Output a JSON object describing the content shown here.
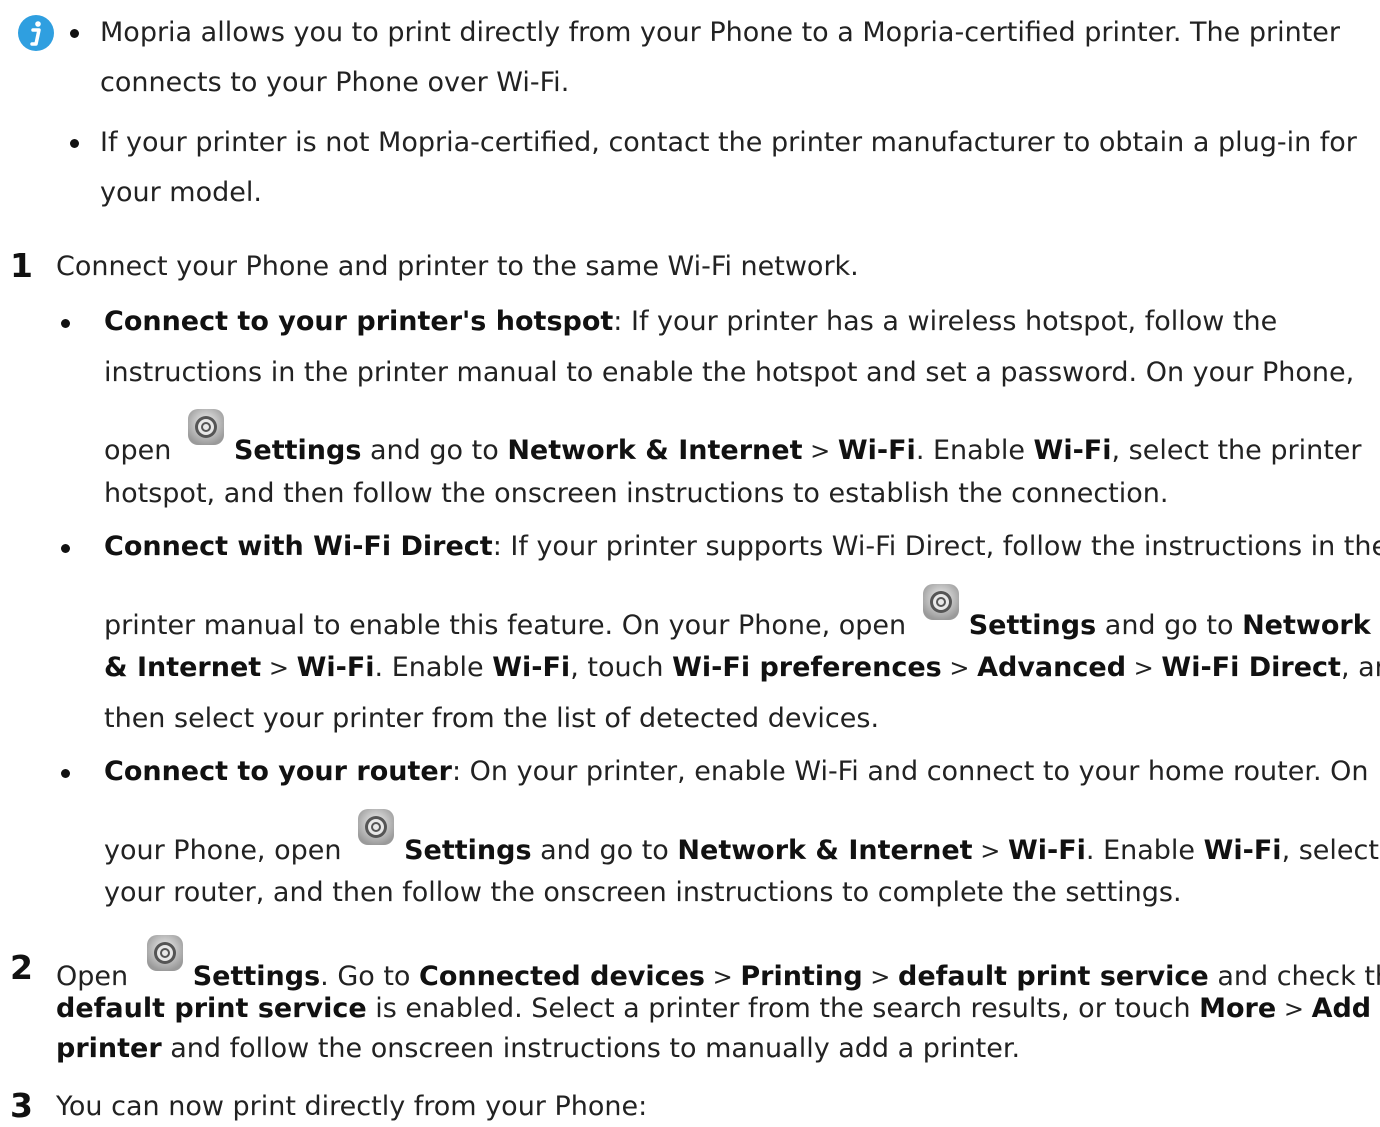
{
  "note": {
    "icon": "info-icon",
    "items": [
      [
        "Mopria allows you to print directly from your Phone to a Mopria-certified printer. The printer",
        "connects to your Phone over Wi-Fi."
      ],
      [
        "If your printer is not Mopria-certified, contact the printer manufacturer to obtain a plug-in for",
        "your model."
      ]
    ]
  },
  "step1": {
    "number": "1",
    "text": "Connect your Phone and printer to the same Wi-Fi network.",
    "b1": {
      "l1_bold": "Connect to your printer's hotspot",
      "l1_rest": ": If your printer has a wireless hotspot, follow the",
      "l2": "instructions in the printer manual to enable the hotspot and set a password. On your Phone,",
      "l3_a": "open ",
      "settings": "Settings",
      "l3_b": " and go to ",
      "network": "Network & Internet",
      "gt": " > ",
      "wifi": "Wi-Fi",
      "l3_c": ". Enable ",
      "wifi2": "Wi-Fi",
      "l3_d": ", select the printer",
      "l4": "hotspot, and then follow the onscreen instructions to establish the connection."
    },
    "b2": {
      "l1_bold": "Connect with Wi-Fi Direct",
      "l1_rest": ": If your printer supports Wi-Fi Direct, follow the instructions in the",
      "l2_a": "printer manual to enable this feature. On your Phone, open ",
      "settings": "Settings",
      "l2_b": " and go to ",
      "network": "Network",
      "l3_a": "& Internet",
      "gt": " > ",
      "wifi": "Wi-Fi",
      "l3_b": ". Enable ",
      "wifi2": "Wi-Fi",
      "l3_c": ", touch ",
      "prefs": "Wi-Fi preferences",
      "advanced": "Advanced",
      "direct": "Wi-Fi Direct",
      "l3_d": ", and",
      "l4": "then select your printer from the list of detected devices."
    },
    "b3": {
      "l1_bold": "Connect to your router",
      "l1_rest": ": On your printer, enable Wi-Fi and connect to your home router. On",
      "l2_a": "your Phone, open ",
      "settings": "Settings",
      "l2_b": " and go to ",
      "network": "Network & Internet",
      "gt": " > ",
      "wifi": "Wi-Fi",
      "l2_c": ". Enable ",
      "wifi2": "Wi-Fi",
      "l2_d": ", select",
      "l3": "your router, and then follow the onscreen instructions to complete the settings."
    }
  },
  "step2": {
    "number": "2",
    "l1_a": "Open ",
    "settings": "Settings",
    "l1_b": ". Go to ",
    "connected": "Connected devices",
    "gt": " > ",
    "printing": "Printing",
    "dps": "default print service",
    "l1_c": " and check that",
    "l2_bold": "default print service",
    "l2_a": " is enabled. Select a printer from the search results, or touch ",
    "more": "More",
    "add": "Add",
    "l3_bold": "printer",
    "l3_a": " and follow the onscreen instructions to manually add a printer."
  },
  "step3": {
    "number": "3",
    "text": "You can now print directly from your Phone:"
  }
}
